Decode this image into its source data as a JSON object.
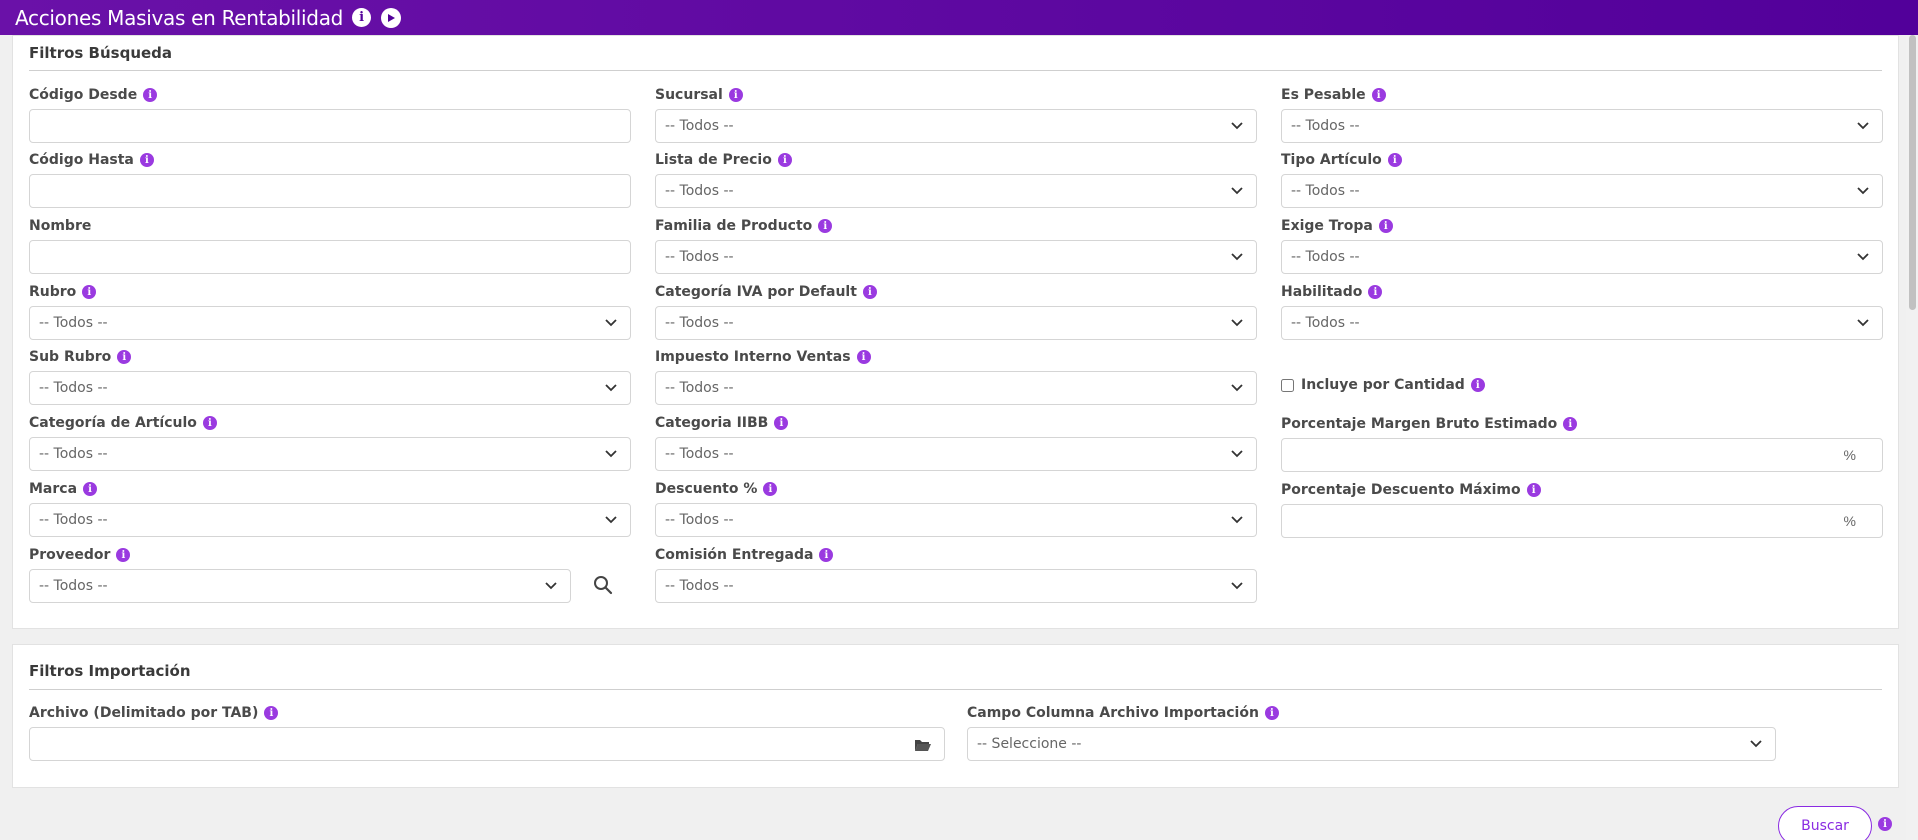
{
  "header": {
    "title": "Acciones Masivas en Rentabilidad",
    "info_icon": "info-icon",
    "play_icon": "play-icon"
  },
  "busqueda": {
    "title": "Filtros Búsqueda",
    "codigo_desde": {
      "label": "Código Desde",
      "value": ""
    },
    "codigo_hasta": {
      "label": "Código Hasta",
      "value": ""
    },
    "nombre": {
      "label": "Nombre",
      "value": ""
    },
    "rubro": {
      "label": "Rubro",
      "value": "-- Todos --"
    },
    "sub_rubro": {
      "label": "Sub Rubro",
      "value": "-- Todos --"
    },
    "categoria_articulo": {
      "label": "Categoría de Artículo",
      "value": "-- Todos --"
    },
    "marca": {
      "label": "Marca",
      "value": "-- Todos --"
    },
    "proveedor": {
      "label": "Proveedor",
      "value": "-- Todos --"
    },
    "sucursal": {
      "label": "Sucursal",
      "value": "-- Todos --"
    },
    "lista_precio": {
      "label": "Lista de Precio",
      "value": "-- Todos --"
    },
    "familia_producto": {
      "label": "Familia de Producto",
      "value": "-- Todos --"
    },
    "categoria_iva": {
      "label": "Categoría IVA por Default",
      "value": "-- Todos --"
    },
    "impuesto_interno": {
      "label": "Impuesto Interno Ventas",
      "value": "-- Todos --"
    },
    "categoria_iibb": {
      "label": "Categoria IIBB",
      "value": "-- Todos --"
    },
    "descuento": {
      "label": "Descuento %",
      "value": "-- Todos --"
    },
    "comision": {
      "label": "Comisión Entregada",
      "value": "-- Todos --"
    },
    "es_pesable": {
      "label": "Es Pesable",
      "value": "-- Todos --"
    },
    "tipo_articulo": {
      "label": "Tipo Artículo",
      "value": "-- Todos --"
    },
    "exige_tropa": {
      "label": "Exige Tropa",
      "value": "-- Todos --"
    },
    "habilitado": {
      "label": "Habilitado",
      "value": "-- Todos --"
    },
    "incluye_cantidad": {
      "label": "Incluye por Cantidad",
      "checked": false
    },
    "margen_bruto": {
      "label": "Porcentaje Margen Bruto Estimado",
      "value": "",
      "suffix": "%"
    },
    "descuento_maximo": {
      "label": "Porcentaje Descuento Máximo",
      "value": "",
      "suffix": "%"
    }
  },
  "importacion": {
    "title": "Filtros Importación",
    "archivo": {
      "label": "Archivo (Delimitado por TAB)",
      "value": ""
    },
    "campo_columna": {
      "label": "Campo Columna Archivo Importación",
      "value": "-- Seleccione --"
    }
  },
  "actions": {
    "buscar": "Buscar"
  },
  "colors": {
    "header": "#52009a",
    "accent": "#9a3ae0"
  }
}
